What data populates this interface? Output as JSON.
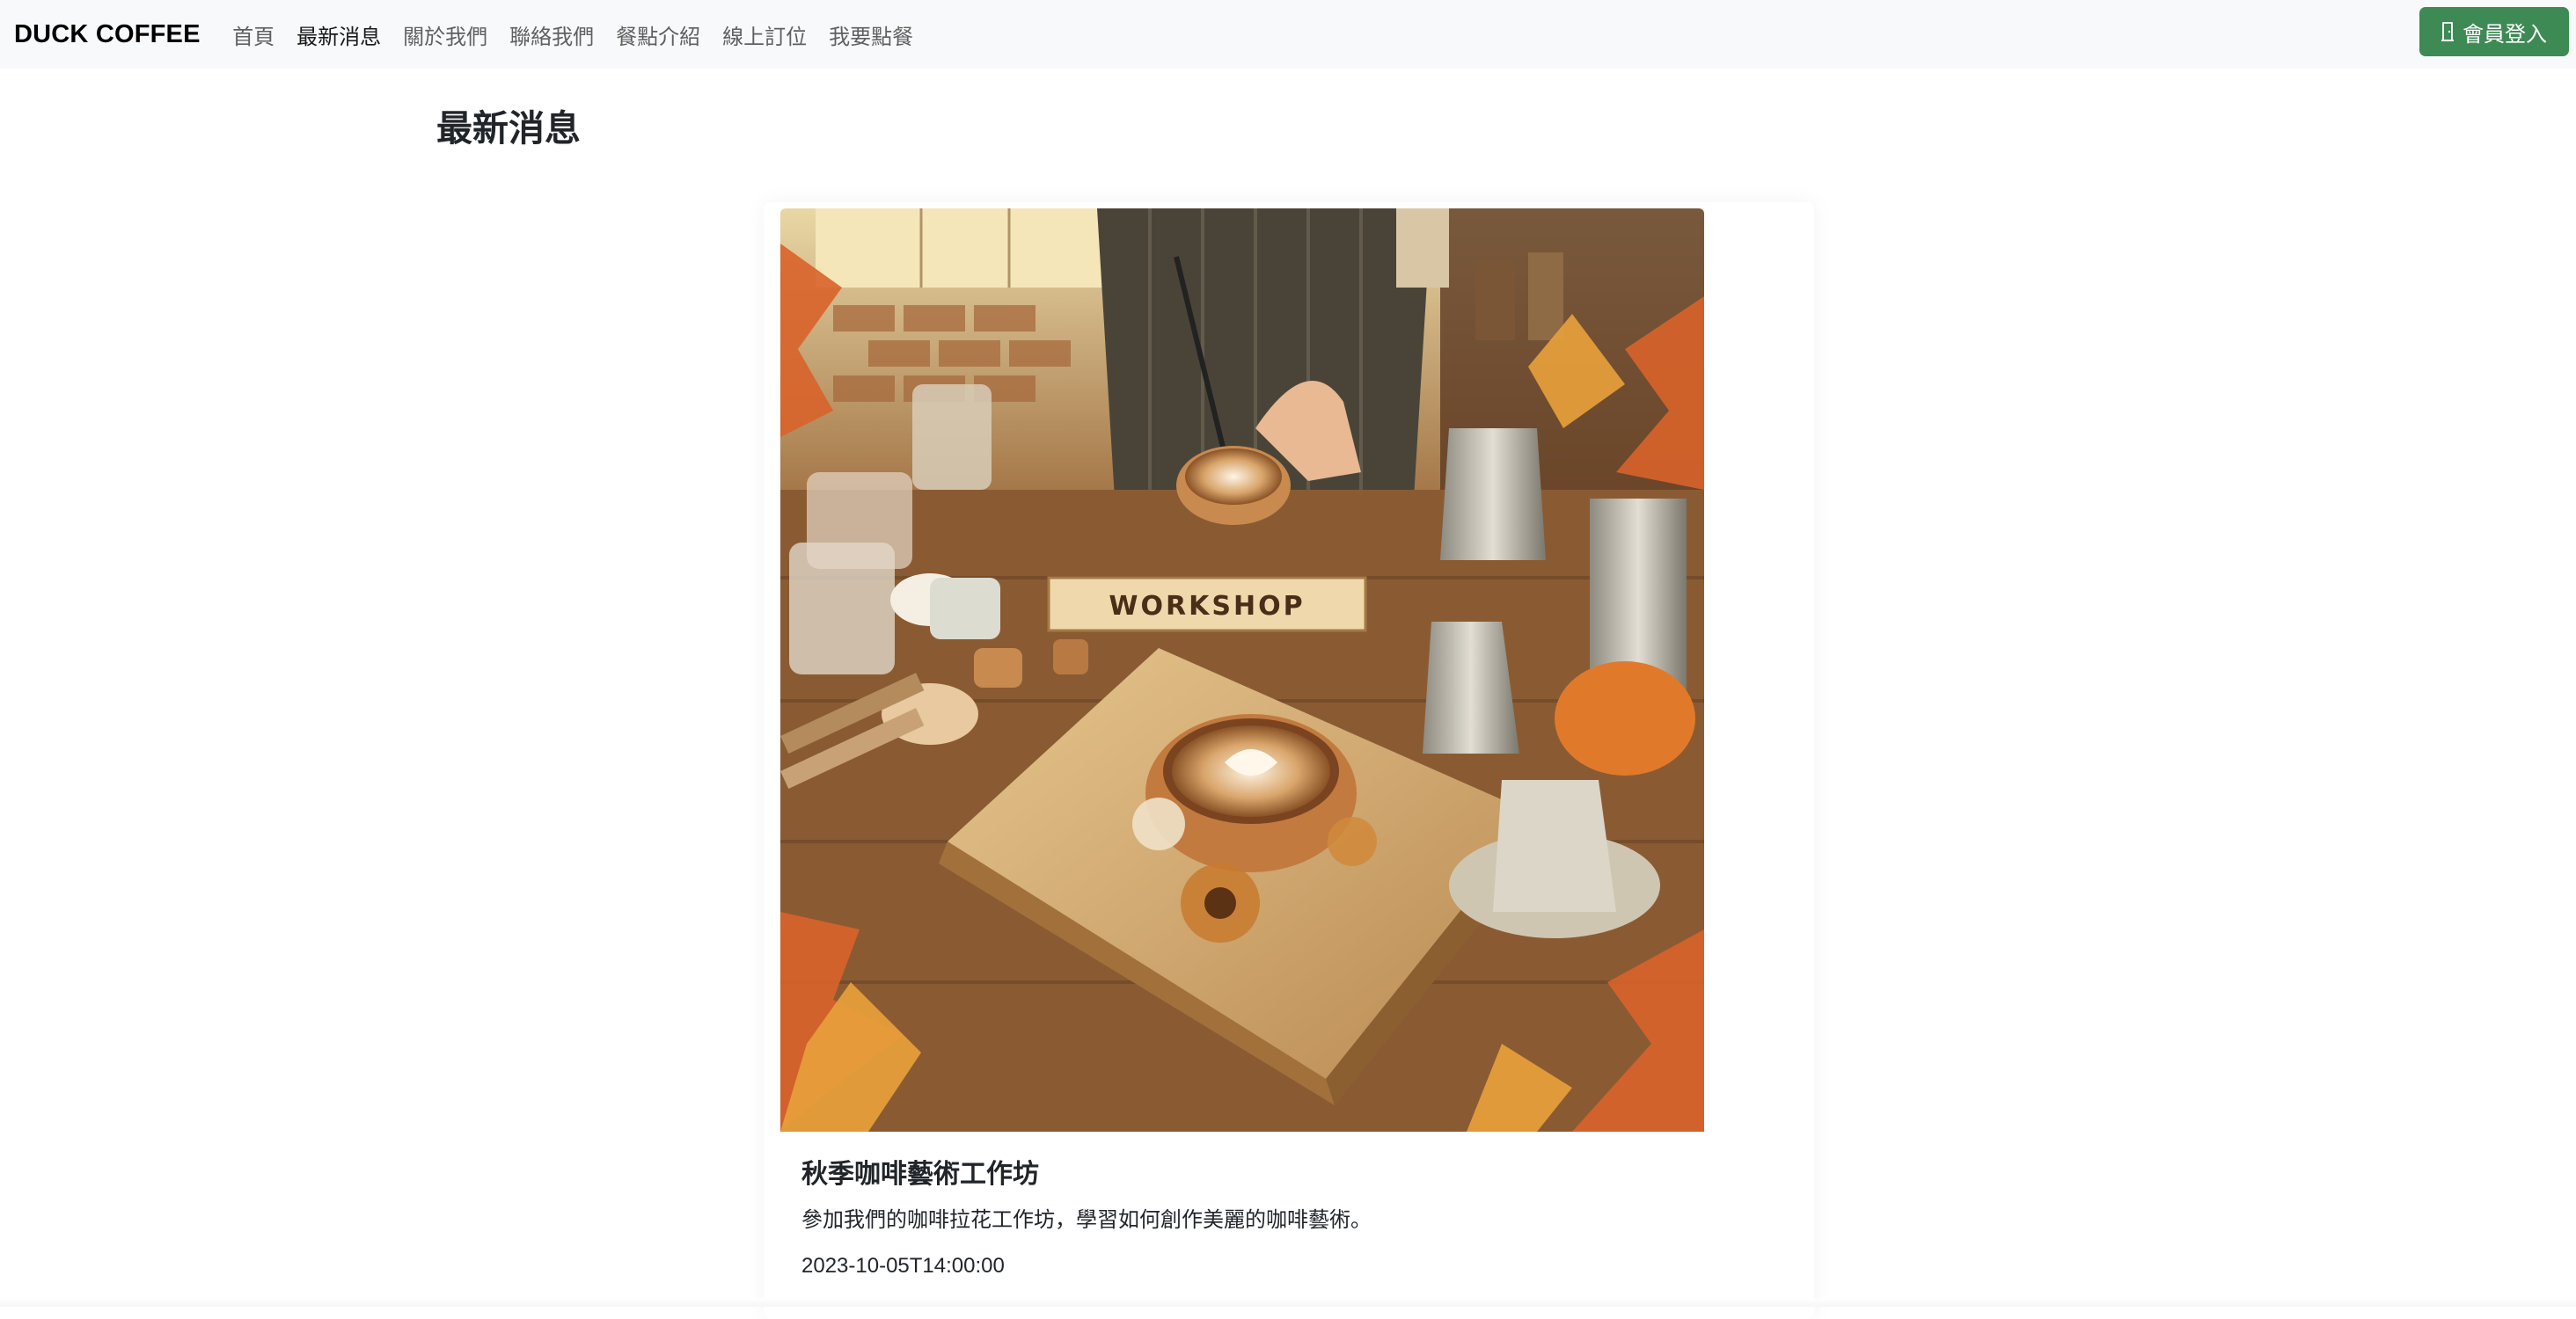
{
  "navbar": {
    "brand": "DUCK COFFEE",
    "links": [
      {
        "label": "首頁",
        "active": false
      },
      {
        "label": "最新消息",
        "active": true
      },
      {
        "label": "關於我們",
        "active": false
      },
      {
        "label": "聯絡我們",
        "active": false
      },
      {
        "label": "餐點介紹",
        "active": false
      },
      {
        "label": "線上訂位",
        "active": false
      },
      {
        "label": "我要點餐",
        "active": false
      }
    ],
    "login_label": "會員登入",
    "login_icon": "door-icon",
    "login_color": "#3e8a54"
  },
  "page": {
    "title": "最新消息"
  },
  "news": [
    {
      "image_label": "WORKSHOP",
      "title": "秋季咖啡藝術工作坊",
      "description": "參加我們的咖啡拉花工作坊，學習如何創作美麗的咖啡藝術。",
      "date": "2023-10-05T14:00:00"
    }
  ]
}
